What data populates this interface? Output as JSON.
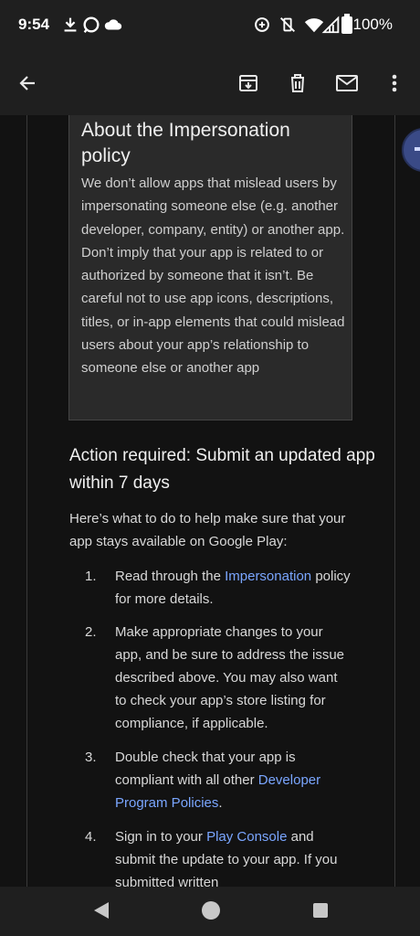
{
  "status_bar": {
    "time": "9:54",
    "battery": "100%",
    "icons": [
      "download-icon",
      "messenger-icon",
      "cloud-icon",
      "data-saver-icon",
      "vibrate-off-icon",
      "wifi-icon",
      "signal-icon",
      "battery-icon"
    ]
  },
  "app_bar": {
    "icons": [
      "back-arrow-icon",
      "archive-icon",
      "delete-icon",
      "mark-unread-icon",
      "more-vert-icon"
    ]
  },
  "policy_box": {
    "title": "About the Impersonation policy",
    "body": "We don’t allow apps that mislead users by impersonating someone else (e.g. another developer, company, entity) or another app. Don’t imply that your app is related to or authorized by someone that it isn’t. Be careful not to use app icons, descriptions, titles, or in-app elements that could mislead users about your app’s relationship to someone else or another app"
  },
  "action": {
    "title": "Action required: Submit an updated app within 7 days",
    "intro": "Here’s what to do to help make sure that your app stays available on Google Play:"
  },
  "steps": [
    {
      "num": "1.",
      "before": "Read through the ",
      "link": "Impersonation",
      "after": " policy for more details."
    },
    {
      "num": "2.",
      "before": "Make appropriate changes to your app, and be sure to address the issue described above. You may also want to check your app’s store listing for compliance, if applicable.",
      "link": "",
      "after": ""
    },
    {
      "num": "3.",
      "before": "Double check that your app is compliant with all other ",
      "link": "Developer Program Policies",
      "after": "."
    },
    {
      "num": "4.",
      "before": "Sign in to your ",
      "link": "Play Console",
      "after": " and submit the update to your app. If you submitted written"
    }
  ],
  "colors": {
    "background": "#121212",
    "bars": "#1f1f1f",
    "box": "#2a2a2a",
    "link": "#7aa6ff"
  },
  "nav_bar": {
    "icons": [
      "back-triangle-icon",
      "home-circle-icon",
      "recents-square-icon"
    ]
  }
}
